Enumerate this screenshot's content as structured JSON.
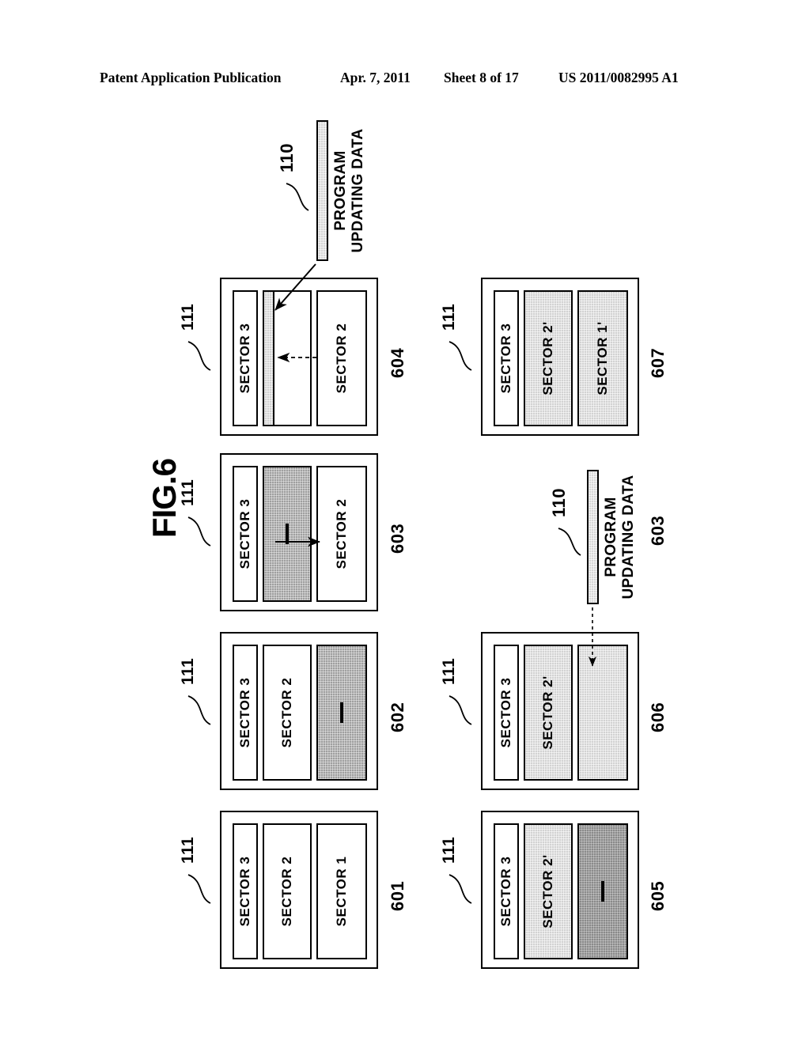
{
  "header": {
    "publication": "Patent Application Publication",
    "date": "Apr. 7, 2011",
    "sheet": "Sheet 8 of 17",
    "number": "US 2011/0082995 A1"
  },
  "figure": {
    "title": "FIG.6",
    "module_ref": "111",
    "data_ref": "110",
    "program_data_label_line1": "PROGRAM",
    "program_data_label_line2": "UPDATING DATA"
  },
  "colors": {
    "ink": "#000000",
    "paper": "#ffffff",
    "fill_light": "#d2d2d2",
    "fill_mid": "#9f9f9f",
    "fill_dark": "#8a8a8a"
  },
  "diagrams": [
    {
      "id": "601",
      "ref": "601",
      "module_ref": "111",
      "sectors": [
        {
          "label": "SECTOR 3",
          "fill": "white",
          "erased": false
        },
        {
          "label": "SECTOR 2",
          "fill": "white",
          "erased": false
        },
        {
          "label": "SECTOR 1",
          "fill": "white",
          "erased": false
        }
      ]
    },
    {
      "id": "602",
      "ref": "602",
      "module_ref": "111",
      "sectors": [
        {
          "label": "SECTOR 3",
          "fill": "white",
          "erased": false
        },
        {
          "label": "SECTOR 2",
          "fill": "white",
          "erased": false
        },
        {
          "label": "",
          "fill": "mid",
          "erased": true
        }
      ]
    },
    {
      "id": "603",
      "ref": "603",
      "module_ref": "111",
      "sectors": [
        {
          "label": "SECTOR 3",
          "fill": "white",
          "erased": false
        },
        {
          "label": "",
          "fill": "mid",
          "erased": true
        },
        {
          "label": "SECTOR 2",
          "fill": "white",
          "erased": false
        }
      ]
    },
    {
      "id": "604",
      "ref": "604",
      "module_ref": "111",
      "sectors": [
        {
          "label": "SECTOR 3",
          "fill": "white",
          "erased": false
        },
        {
          "label": "",
          "fill": "white",
          "erased": false,
          "stripe": "light"
        },
        {
          "label": "SECTOR 2",
          "fill": "white",
          "erased": false
        }
      ]
    },
    {
      "id": "605",
      "ref": "605",
      "module_ref": "111",
      "sectors": [
        {
          "label": "SECTOR 3",
          "fill": "white",
          "erased": false
        },
        {
          "label": "SECTOR 2'",
          "fill": "light",
          "erased": false
        },
        {
          "label": "",
          "fill": "dark",
          "erased": true
        }
      ]
    },
    {
      "id": "606",
      "ref": "606",
      "module_ref": "111",
      "sectors": [
        {
          "label": "SECTOR 3",
          "fill": "white",
          "erased": false
        },
        {
          "label": "SECTOR 2'",
          "fill": "light",
          "erased": false
        },
        {
          "label": "",
          "fill": "light",
          "erased": false
        }
      ]
    },
    {
      "id": "607",
      "ref": "607",
      "module_ref": "111",
      "sectors": [
        {
          "label": "SECTOR 3",
          "fill": "white",
          "erased": false
        },
        {
          "label": "SECTOR 2'",
          "fill": "light",
          "erased": false
        },
        {
          "label": "SECTOR 1'",
          "fill": "light",
          "erased": false
        }
      ]
    }
  ],
  "data_bars": [
    {
      "id": "top",
      "ref": "110",
      "caption_line1": "PROGRAM",
      "caption_line2": "UPDATING DATA",
      "stage_ref": ""
    },
    {
      "id": "lower",
      "ref": "110",
      "caption_line1": "PROGRAM",
      "caption_line2": "UPDATING DATA",
      "stage_ref": "603"
    }
  ]
}
